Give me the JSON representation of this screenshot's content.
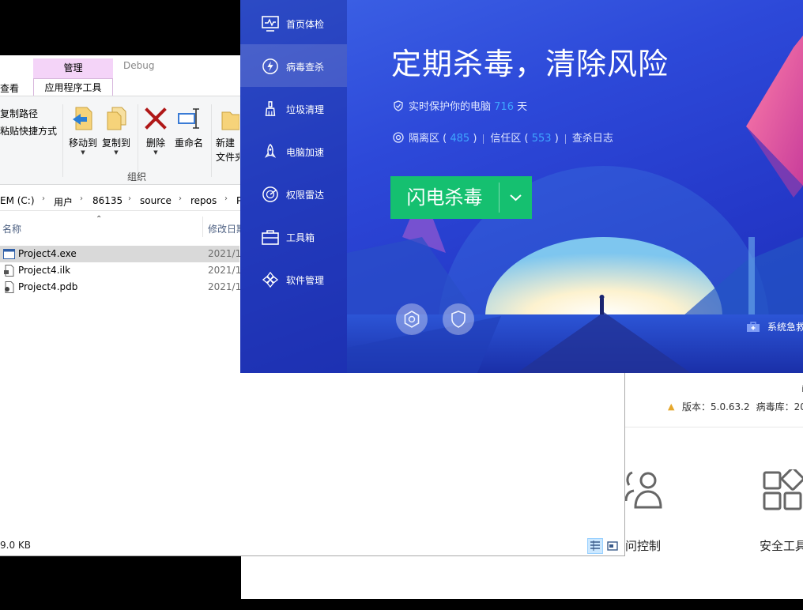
{
  "explorer": {
    "tabs": {
      "manage": "管理",
      "debug": "Debug",
      "view": "查看",
      "app_tools": "应用程序工具"
    },
    "ribbon": {
      "copy_path": "复制路径",
      "paste_shortcut": "粘贴快捷方式",
      "move_to": "移动到",
      "copy_to": "复制到",
      "delete": "删除",
      "rename": "重命名",
      "new": "新建",
      "new_folder": "文件夹",
      "group_organize": "组织"
    },
    "address": {
      "crumbs": [
        "EM (C:)",
        "用户",
        "86135",
        "source",
        "repos",
        "P"
      ]
    },
    "columns": {
      "name": "名称",
      "date": "修改日期"
    },
    "files": [
      {
        "name": "Project4.exe",
        "date": "2021/1",
        "selected": true,
        "icon": "exe-file-icon"
      },
      {
        "name": "Project4.ilk",
        "date": "2021/1",
        "selected": false,
        "icon": "ilk-file-icon"
      },
      {
        "name": "Project4.pdb",
        "date": "2021/1",
        "selected": false,
        "icon": "pdb-file-icon"
      }
    ],
    "status": "9.0 KB"
  },
  "security_app": {
    "sidebar": [
      {
        "label": "首页体检",
        "icon": "monitor-check-icon",
        "active": false
      },
      {
        "label": "病毒查杀",
        "icon": "lightning-icon",
        "active": true
      },
      {
        "label": "垃圾清理",
        "icon": "broom-icon",
        "active": false
      },
      {
        "label": "电脑加速",
        "icon": "rocket-icon",
        "active": false
      },
      {
        "label": "权限雷达",
        "icon": "radar-icon",
        "active": false
      },
      {
        "label": "工具箱",
        "icon": "toolbox-icon",
        "active": false
      },
      {
        "label": "软件管理",
        "icon": "software-icon",
        "active": false
      }
    ],
    "headline": "定期杀毒，清除风险",
    "protect": {
      "prefix": "实时保护你的电脑",
      "days": "716",
      "suffix": "天"
    },
    "quarantine": {
      "label": "隔离区",
      "count": "485"
    },
    "trust": {
      "label": "信任区",
      "count": "553"
    },
    "scan_log": "查杀日志",
    "scan_button": "闪电杀毒",
    "rescue": "系统急救",
    "colors": {
      "accent_green": "#15c070",
      "number_blue": "#3fa6ff"
    }
  },
  "background_app": {
    "version_label": "版本：5.0.63.2",
    "virus_db_label": "病毒库：20",
    "corner_mark": "i",
    "tools": [
      {
        "label": "问控制",
        "icon": "users-icon"
      },
      {
        "label": "安全工具",
        "icon": "grid-apps-icon"
      }
    ]
  }
}
